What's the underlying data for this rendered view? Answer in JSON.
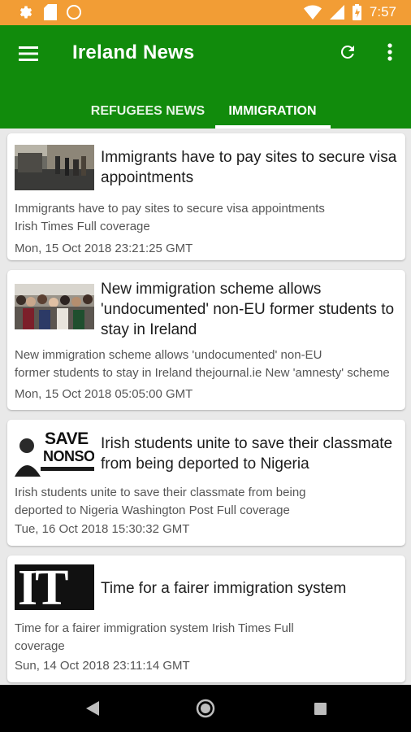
{
  "status_bar": {
    "time": "7:57",
    "icons": [
      "settings-icon",
      "sd-card-icon",
      "circle-icon",
      "wifi-icon",
      "signal-icon",
      "battery-icon"
    ]
  },
  "app_bar": {
    "title": "Ireland News",
    "menu_icon": "hamburger-menu-icon",
    "refresh_icon": "refresh-icon",
    "more_icon": "more-vert-icon"
  },
  "tabs": [
    {
      "label": "REFUGEES NEWS",
      "selected": false
    },
    {
      "label": "IMMIGRATION",
      "selected": true
    }
  ],
  "articles": [
    {
      "headline": "Immigrants have to pay sites to secure visa appointments",
      "snippet_line1": "Immigrants have to pay sites to secure visa appointments",
      "snippet_line2": "Irish Times  Full coverage",
      "date": "Mon, 15 Oct 2018 23:21:25 GMT",
      "thumb": "street-photo"
    },
    {
      "headline": "New immigration scheme allows 'undocumented' non-EU former students to stay in Ireland",
      "snippet_line1": "New immigration scheme allows 'undocumented' non-EU",
      "snippet_line2": "former students to stay in Ireland  thejournal.ie  New 'amnesty' scheme",
      "date": "Mon, 15 Oct 2018 05:05:00 GMT",
      "thumb": "crowd-photo"
    },
    {
      "headline": "Irish students unite to save their classmate from being deported to Nigeria",
      "snippet_line1": "Irish students unite to save their classmate from being",
      "snippet_line2": "deported to Nigeria  Washington Post  Full coverage",
      "date": "Tue, 16 Oct 2018 15:30:32 GMT",
      "thumb": "save-nonso-logo",
      "thumb_text_1": "SAVE",
      "thumb_text_2": "NONSO"
    },
    {
      "headline": "Time for a fairer immigration system",
      "snippet_line1": "Time for a fairer immigration system  Irish Times  Full",
      "snippet_line2": "coverage",
      "date": "Sun, 14 Oct 2018 23:11:14 GMT",
      "thumb": "irish-times-logo",
      "thumb_text_1": "IT"
    }
  ],
  "nav_bar": {
    "back_icon": "back-triangle-icon",
    "home_icon": "home-circle-icon",
    "recents_icon": "recents-square-icon"
  },
  "colors": {
    "status_bar": "#f29d35",
    "app_bar": "#118b0c",
    "background": "#e9e9e9",
    "card": "#ffffff",
    "nav_bar": "#000000"
  }
}
